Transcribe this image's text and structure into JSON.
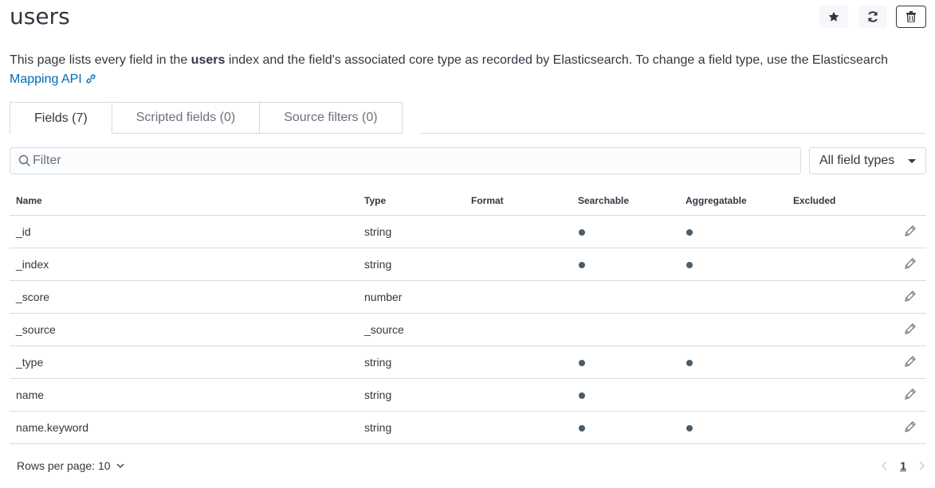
{
  "page": {
    "title": "users"
  },
  "header_actions": {
    "favorite_icon": "star-icon",
    "refresh_icon": "refresh-icon",
    "delete_icon": "trash-icon"
  },
  "description": {
    "prefix": "This page lists every field in the ",
    "index_name": "users",
    "middle": " index and the field's associated core type as recorded by Elasticsearch. To change a field type, use the Elasticsearch ",
    "link_label": "Mapping API"
  },
  "tabs": [
    {
      "label": "Fields (7)",
      "selected": true
    },
    {
      "label": "Scripted fields (0)",
      "selected": false
    },
    {
      "label": "Source filters (0)",
      "selected": false
    }
  ],
  "filter": {
    "placeholder": "Filter",
    "value": ""
  },
  "type_select": {
    "value": "All field types"
  },
  "table": {
    "columns": [
      "Name",
      "Type",
      "Format",
      "Searchable",
      "Aggregatable",
      "Excluded"
    ],
    "rows": [
      {
        "name": "_id",
        "type": "string",
        "format": "",
        "searchable": true,
        "aggregatable": true,
        "excluded": false
      },
      {
        "name": "_index",
        "type": "string",
        "format": "",
        "searchable": true,
        "aggregatable": true,
        "excluded": false
      },
      {
        "name": "_score",
        "type": "number",
        "format": "",
        "searchable": false,
        "aggregatable": false,
        "excluded": false
      },
      {
        "name": "_source",
        "type": "_source",
        "format": "",
        "searchable": false,
        "aggregatable": false,
        "excluded": false
      },
      {
        "name": "_type",
        "type": "string",
        "format": "",
        "searchable": true,
        "aggregatable": true,
        "excluded": false
      },
      {
        "name": "name",
        "type": "string",
        "format": "",
        "searchable": true,
        "aggregatable": false,
        "excluded": false
      },
      {
        "name": "name.keyword",
        "type": "string",
        "format": "",
        "searchable": true,
        "aggregatable": true,
        "excluded": false
      }
    ]
  },
  "pagination": {
    "rows_per_page_label": "Rows per page: 10",
    "current_page": "1"
  },
  "colors": {
    "link": "#006bb4",
    "text": "#343741",
    "border": "#d3dae6",
    "dot": "#4c5c68"
  }
}
